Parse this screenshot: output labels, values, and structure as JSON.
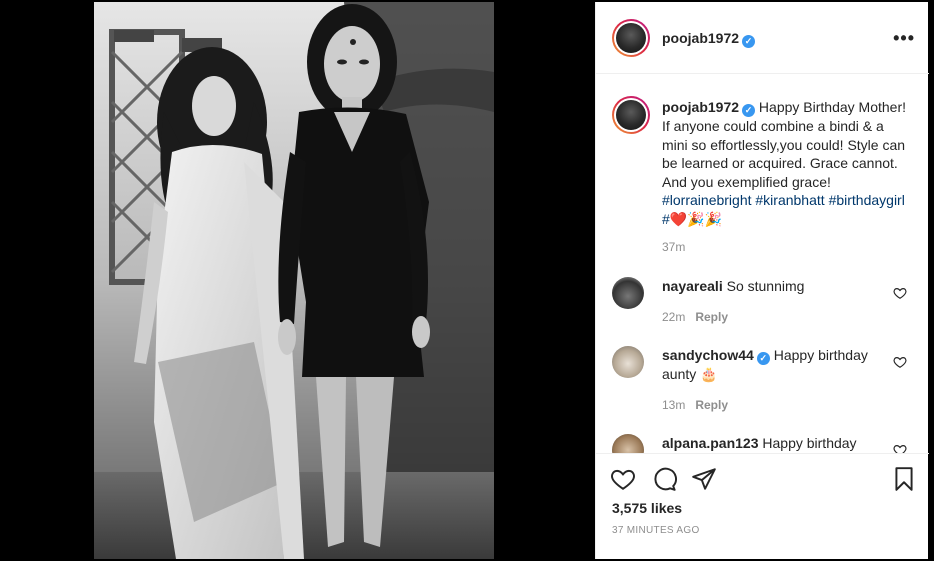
{
  "post": {
    "author": "poojab1972",
    "caption_text": "Happy Birthday Mother! If anyone could combine a bindi & a mini so effortlessly,you could! Style can be learned or acquired. Grace cannot. And you exemplified grace!",
    "hashtags": [
      "#lorrainebright",
      "#kiranbhatt",
      "#birthdaygirl",
      "#"
    ],
    "caption_emoji": "❤️🎉🎉",
    "caption_time": "37m",
    "likes": "3,575 likes",
    "posted_ago": "37 MINUTES AGO",
    "more_icon": "more-horizontal-icon"
  },
  "comments": [
    {
      "user": "nayareali",
      "text": "So stunnimg",
      "time": "22m",
      "reply": "Reply",
      "verified": false
    },
    {
      "user": "sandychow44",
      "text": "Happy birthday aunty 🎂",
      "time": "13m",
      "reply": "Reply",
      "verified": true
    },
    {
      "user": "alpana.pan123",
      "text": "Happy birthday",
      "time": "",
      "reply": "",
      "verified": false
    }
  ],
  "icons": {
    "like": "heart-icon",
    "comment": "comment-icon",
    "share": "share-icon",
    "save": "bookmark-icon"
  },
  "colors": {
    "verified": "#3897f0",
    "hashtag": "#00376b",
    "muted": "#8e8e8e",
    "emoji_heart": "#e0245e"
  }
}
